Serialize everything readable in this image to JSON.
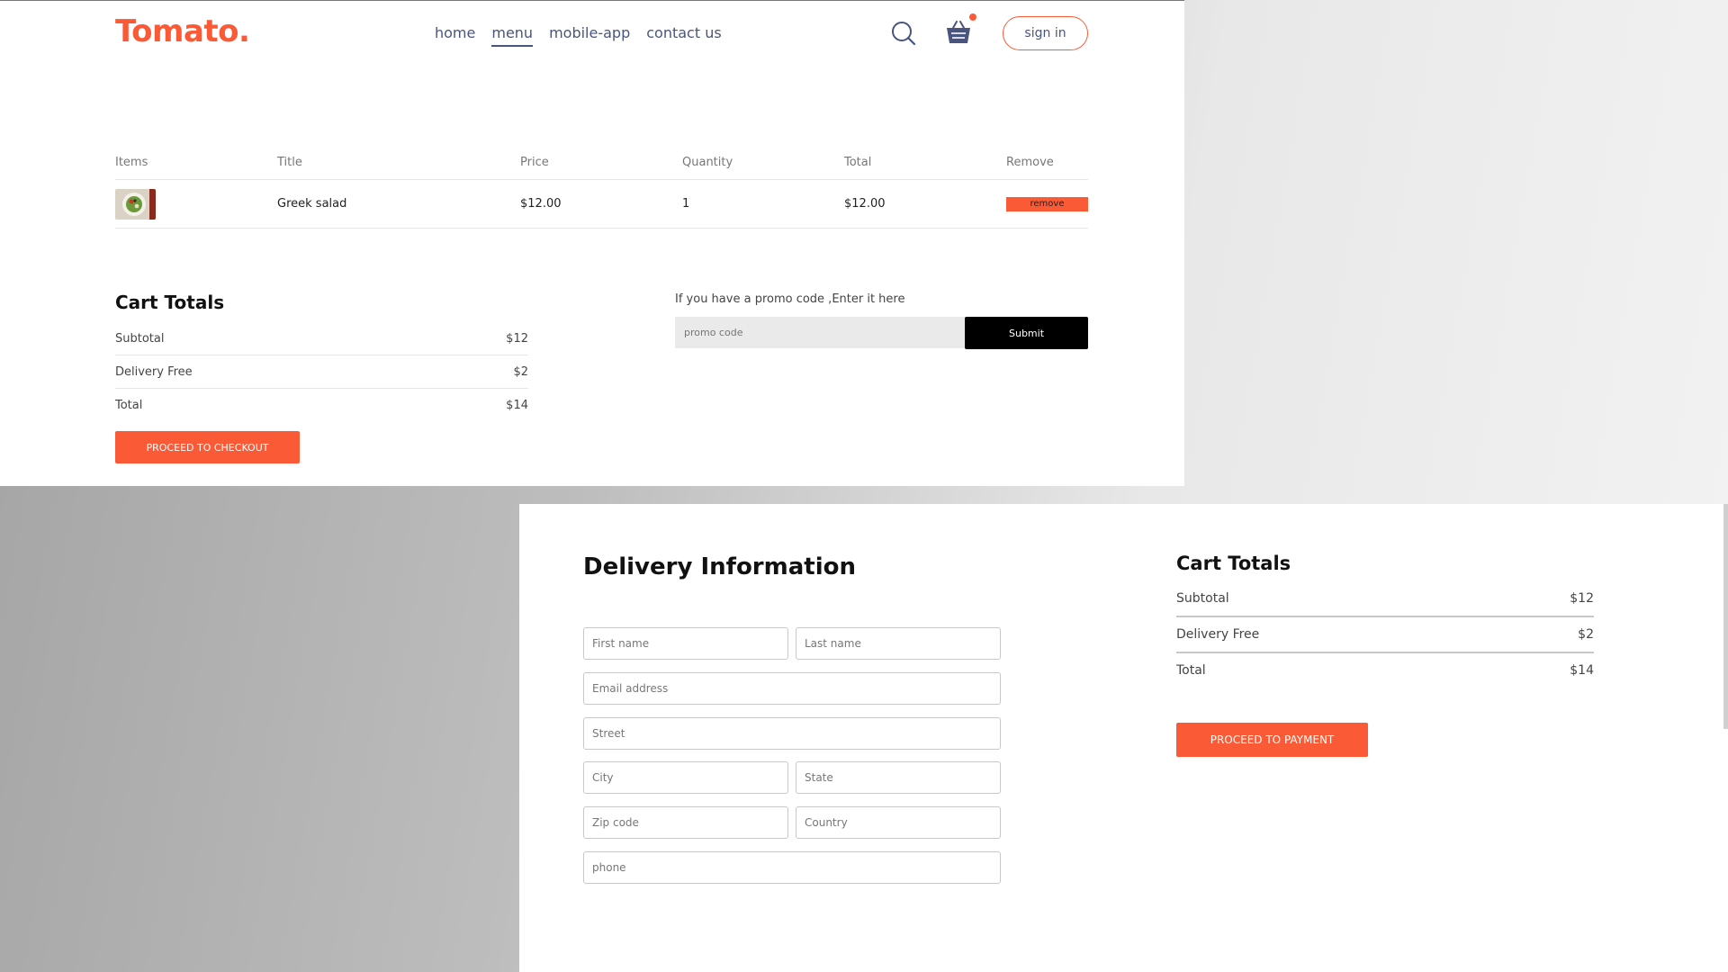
{
  "brand": {
    "logo_text": "Tomato.",
    "accent_color": "#fa5a36"
  },
  "navbar": {
    "links": [
      "home",
      "menu",
      "mobile-app",
      "contact us"
    ],
    "active_link": "menu",
    "search_icon": "search-icon",
    "basket_icon": "basket-icon",
    "signin_label": "sign in"
  },
  "cart": {
    "headers": [
      "Items",
      "Title",
      "Price",
      "Quantity",
      "Total",
      "Remove"
    ],
    "items": [
      {
        "image_icon": "salad-image",
        "title": "Greek salad",
        "price": "$12.00",
        "quantity": "1",
        "total": "$12.00",
        "remove_label": "remove"
      }
    ],
    "totals": {
      "title": "Cart Totals",
      "subtotal_label": "Subtotal",
      "subtotal": "$12",
      "delivery_label": "Delivery Free",
      "delivery": "$2",
      "total_label": "Total",
      "total": "$14"
    },
    "checkout_label": "PROCEED TO CHECKOUT",
    "promo": {
      "prompt": "If you have a promo code ,Enter it here",
      "placeholder": "promo code",
      "submit_label": "Submit"
    }
  },
  "delivery": {
    "title": "Delivery Information",
    "placeholders": {
      "first_name": "First name",
      "last_name": "Last name",
      "email": "Email address",
      "street": "Street",
      "city": "City",
      "state": "State",
      "zip": "Zip code",
      "country": "Country",
      "phone": "phone"
    }
  },
  "order_totals": {
    "title": "Cart Totals",
    "subtotal_label": "Subtotal",
    "subtotal": "$12",
    "delivery_label": "Delivery Free",
    "delivery": "$2",
    "total_label": "Total",
    "total": "$14",
    "payment_label": "PROCEED TO PAYMENT"
  }
}
